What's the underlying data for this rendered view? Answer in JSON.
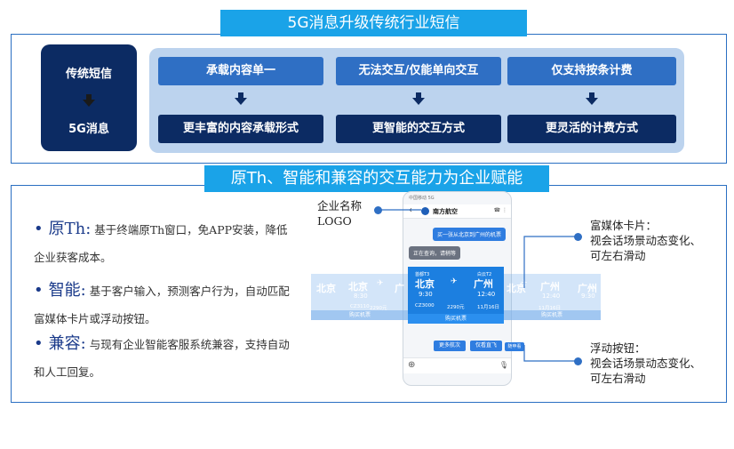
{
  "top_section": {
    "title": "5G消息升级传统行业短信",
    "left_panel": {
      "from": "传统短信",
      "to": "5G消息"
    },
    "limitations": [
      "承载内容单一",
      "无法交互/仅能单向交互",
      "仅支持按条计费"
    ],
    "upgrades": [
      "更丰富的内容承载形式",
      "更智能的交互方式",
      "更灵活的计费方式"
    ]
  },
  "bottom_section": {
    "title": "原Th、智能和兼容的交互能力为企业赋能",
    "features": [
      {
        "head": "原Th:",
        "text": "基于终端原Th窗口，免APP安装，降低企业获客成本。"
      },
      {
        "head": "智能:",
        "text": "基于客户输入，预测客户行为，自动匹配富媒体卡片或浮动按钮。"
      },
      {
        "head": "兼容:",
        "text": "与现有企业智能客服系统兼容，支持自动和人工回复。"
      }
    ],
    "annotations": {
      "brand": [
        "企业名称",
        "LOGO"
      ],
      "rich_card": [
        "富媒体卡片：",
        "视会话场景动态变化、",
        "可左右滑动"
      ],
      "float_button": [
        "浮动按钮：",
        "视会话场景动态变化、",
        "可左右滑动"
      ]
    }
  },
  "phone": {
    "status": "中国移动 5G",
    "brand_name": "南方航空",
    "header_icons": "☎ ⋮",
    "user_message": "买一张从北京到广州的机票",
    "bot_message": "正在查询，请稍等",
    "main_card": {
      "from_label": "首都T3",
      "to_label": "白云T2",
      "from_city": "北京",
      "to_city": "广州",
      "dep_time": "9:30",
      "arr_time": "12:40",
      "flight": "CZ3000",
      "price": "2290元",
      "date": "11月16日",
      "button": "购买机票"
    },
    "left_card": {
      "city_a": "北京",
      "city_b": "北京",
      "city_c": "广",
      "time_a": "8:30",
      "flight": "CZ3110",
      "price": "2290元",
      "button": "购买机票"
    },
    "right_card": {
      "city_a": "北京",
      "city_b": "广州",
      "city_c": "广州",
      "time_a": "12:40",
      "time_b": "9:30",
      "date": "11月16日",
      "button": "购买机票"
    },
    "chips": [
      "更多航次",
      "仅看直飞",
      "随申看"
    ],
    "colors": {
      "accent": "#1aa3e8",
      "navy": "#0c2b63",
      "card": "#1c7fe0"
    }
  }
}
